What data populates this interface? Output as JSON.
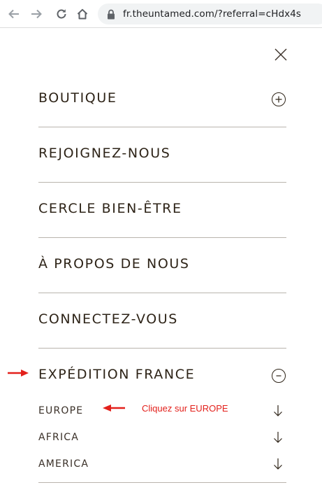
{
  "browser": {
    "url": "fr.theuntamed.com/?referral=cHdx4s"
  },
  "menu": {
    "items": [
      {
        "label": "BOUTIQUE",
        "toggle": "+"
      },
      {
        "label": "REJOIGNEZ-NOUS"
      },
      {
        "label": "CERCLE BIEN-ÊTRE"
      },
      {
        "label": "À PROPOS DE NOUS"
      },
      {
        "label": "CONNECTEZ-VOUS"
      },
      {
        "label": "EXPÉDITION FRANCE",
        "toggle": "−"
      }
    ],
    "shipping_options": [
      "EUROPE",
      "AFRICA",
      "AMERICA"
    ]
  },
  "annotation": {
    "text": "Cliquez sur EUROPE",
    "color": "#e3201b"
  },
  "icons": {
    "back": "arrow-left-icon",
    "forward": "arrow-right-icon",
    "reload": "reload-icon",
    "home": "home-icon",
    "lock": "lock-icon",
    "close": "close-icon",
    "expand": "plus-circle-icon",
    "collapse": "minus-circle-icon",
    "option": "arrow-down-icon"
  }
}
